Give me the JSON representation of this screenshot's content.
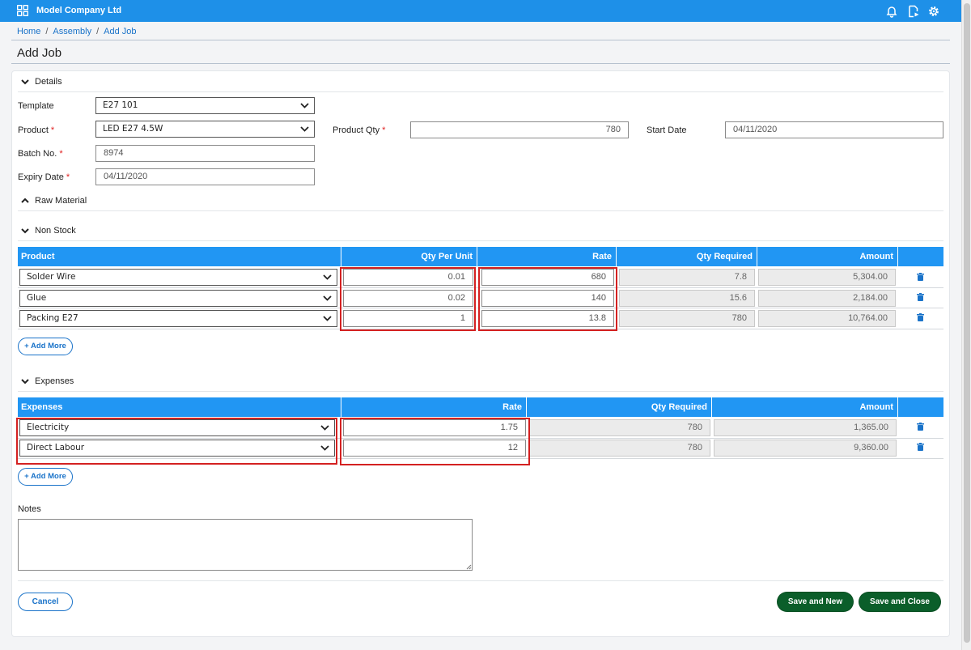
{
  "header": {
    "company": "Model Company Ltd",
    "icons": [
      "apps-grid-icon",
      "bell-icon",
      "document-play-icon",
      "gear-icon"
    ],
    "brand_color": "#1e90e8"
  },
  "breadcrumb": [
    "Home",
    "Assembly",
    "Add Job"
  ],
  "page_title": "Add Job",
  "details": {
    "section_label": "Details",
    "template_label": "Template",
    "template_value": "E27 101",
    "product_label": "Product",
    "product_value": "LED E27 4.5W",
    "product_qty_label": "Product Qty",
    "product_qty_value": "780",
    "start_date_label": "Start Date",
    "start_date_value": "04/11/2020",
    "batch_label": "Batch No.",
    "batch_value": "8974",
    "expiry_label": "Expiry Date",
    "expiry_value": "04/11/2020",
    "required_mark": "*"
  },
  "raw_material": {
    "section_label": "Raw Material"
  },
  "non_stock": {
    "section_label": "Non Stock",
    "columns": [
      "Product",
      "Qty Per Unit",
      "Rate",
      "Qty Required",
      "Amount"
    ],
    "rows": [
      {
        "product": "Solder Wire",
        "qty_per_unit": "0.01",
        "rate": "680",
        "qty_required": "7.8",
        "amount": "5,304.00"
      },
      {
        "product": "Glue",
        "qty_per_unit": "0.02",
        "rate": "140",
        "qty_required": "15.6",
        "amount": "2,184.00"
      },
      {
        "product": "Packing E27",
        "qty_per_unit": "1",
        "rate": "13.8",
        "qty_required": "780",
        "amount": "10,764.00"
      }
    ],
    "add_more": "+ Add More"
  },
  "expenses": {
    "section_label": "Expenses",
    "columns": [
      "Expenses",
      "Rate",
      "Qty Required",
      "Amount"
    ],
    "rows": [
      {
        "expense": "Electricity",
        "rate": "1.75",
        "qty_required": "780",
        "amount": "1,365.00"
      },
      {
        "expense": "Direct Labour",
        "rate": "12",
        "qty_required": "780",
        "amount": "9,360.00"
      }
    ],
    "add_more": "+ Add More"
  },
  "notes": {
    "label": "Notes",
    "value": ""
  },
  "footer": {
    "cancel": "Cancel",
    "save_new": "Save and New",
    "save_close": "Save and Close"
  }
}
